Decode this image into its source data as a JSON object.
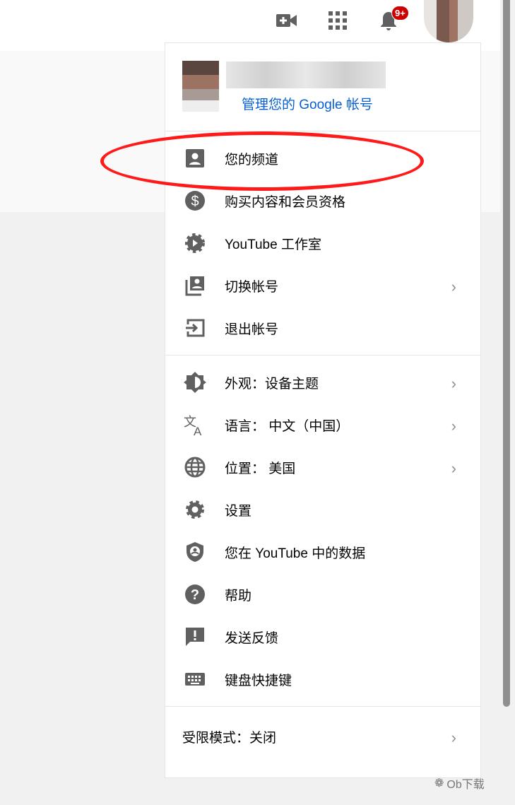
{
  "topbar": {
    "notification_count": "9+"
  },
  "account": {
    "manage_link": "管理您的 Google 帐号"
  },
  "menu": {
    "section1": [
      {
        "label": "您的频道",
        "icon": "account-box-icon"
      },
      {
        "label": "购买内容和会员资格",
        "icon": "dollar-icon"
      },
      {
        "label": "YouTube 工作室",
        "icon": "studio-gear-icon"
      },
      {
        "label": "切换帐号",
        "icon": "switch-account-icon",
        "chevron": true
      },
      {
        "label": "退出帐号",
        "icon": "sign-out-icon"
      }
    ],
    "section2": [
      {
        "label": "外观：设备主题",
        "icon": "appearance-icon"
      },
      {
        "label": "语言： 中文（中国）",
        "icon": "translate-icon"
      },
      {
        "label": "位置： 美国",
        "icon": "globe-icon"
      },
      {
        "label": "设置",
        "icon": "settings-icon"
      },
      {
        "label": "您在 YouTube 中的数据",
        "icon": "shield-icon"
      },
      {
        "label": "帮助",
        "icon": "help-icon"
      },
      {
        "label": "发送反馈",
        "icon": "feedback-icon"
      },
      {
        "label": "键盘快捷键",
        "icon": "keyboard-icon"
      }
    ],
    "restricted": "受限模式：关闭"
  },
  "watermark": "Ob下载",
  "colors": {
    "link": "#065fd4",
    "badge": "#cc0000",
    "highlight": "#ff1a1a"
  }
}
